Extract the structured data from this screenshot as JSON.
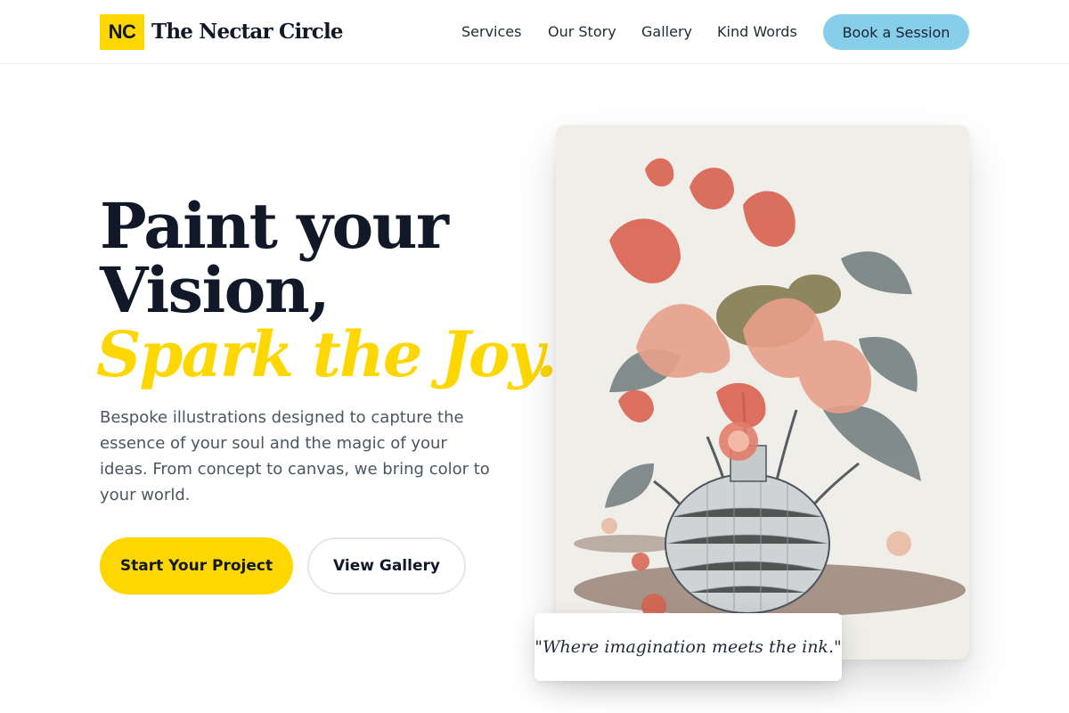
{
  "brand": {
    "badge": "NC",
    "name": "The Nectar Circle"
  },
  "nav": {
    "items": [
      "Services",
      "Our Story",
      "Gallery",
      "Kind Words"
    ],
    "cta": "Book a Session"
  },
  "hero": {
    "line1": "Paint your",
    "line2": "Vision,",
    "accent": "Spark the Joy.",
    "description": "Bespoke illustrations designed to capture the essence of your soul and the magic of your ideas. From concept to canvas, we bring color to your world.",
    "primary_button": "Start Your Project",
    "secondary_button": "View Gallery"
  },
  "artwork": {
    "quote": "\"Where imagination meets the ink.\"",
    "icon": "flower-vase-illustration"
  },
  "colors": {
    "accent_yellow": "#ffd700",
    "accent_blue": "#87ceeb",
    "heading": "#111827",
    "body_text": "#4b5563"
  }
}
